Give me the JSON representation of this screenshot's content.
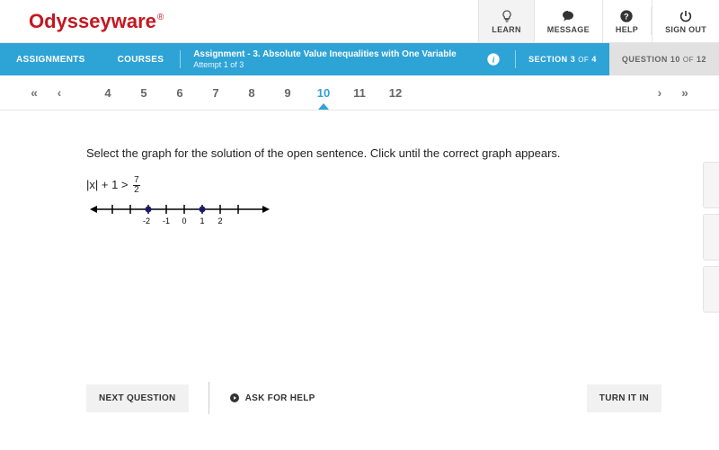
{
  "brand": {
    "name": "Odysseyware",
    "mark": "®"
  },
  "topnav": {
    "learn": "LEARN",
    "message": "MESSAGE",
    "help": "HELP",
    "signout": "SIGN OUT"
  },
  "bluebar": {
    "assignments": "ASSIGNMENTS",
    "courses": "COURSES",
    "assignment_label": "Assignment",
    "assignment_title": "- 3. Absolute Value Inequalities with One Variable",
    "attempt": "Attempt 1 of 3",
    "section_label": "SECTION",
    "section_cur": "3",
    "section_total": "4",
    "section_of": "OF",
    "question_label": "QUESTION",
    "question_cur": "10",
    "question_total": "12",
    "question_of": "OF"
  },
  "qnav": {
    "items": [
      "4",
      "5",
      "6",
      "7",
      "8",
      "9",
      "10",
      "11",
      "12"
    ],
    "active": "10"
  },
  "problem": {
    "instructions": "Select the graph for the solution of the open sentence. Click until the correct graph appears.",
    "expr_left": "|x| + 1 >",
    "frac_num": "7",
    "frac_den": "2",
    "ticks": [
      "-2",
      "-1",
      "0",
      "1",
      "2"
    ]
  },
  "footer": {
    "next": "NEXT QUESTION",
    "ask": "ASK FOR HELP",
    "turnin": "TURN IT IN"
  }
}
